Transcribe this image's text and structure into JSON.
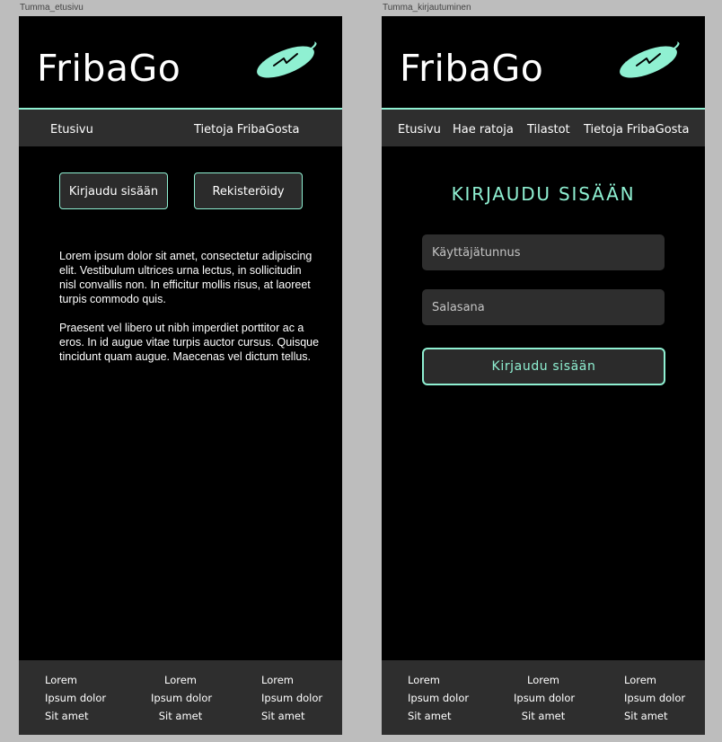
{
  "frames": [
    {
      "label": "Tumma_etusivu",
      "logo_text": "FribaGo",
      "nav": [
        "Etusivu",
        "Tietoja FribaGosta"
      ],
      "buttons": {
        "login": "Kirjaudu sisään",
        "register": "Rekisteröidy"
      },
      "paragraphs": [
        "Lorem ipsum dolor sit amet, consectetur adipiscing elit. Vestibulum ultrices urna lectus, in sollicitudin nisl convallis non. In efficitur mollis risus, at laoreet turpis commodo quis.",
        "Praesent vel libero ut nibh imperdiet porttitor ac a eros. In id augue vitae turpis auctor cursus. Quisque tincidunt quam augue. Maecenas vel dictum tellus."
      ],
      "footer": [
        [
          "Lorem",
          "Ipsum dolor",
          "Sit amet"
        ],
        [
          "Lorem",
          "Ipsum dolor",
          "Sit amet"
        ],
        [
          "Lorem",
          "Ipsum dolor",
          "Sit amet"
        ]
      ]
    },
    {
      "label": "Tumma_kirjautuminen",
      "logo_text": "FribaGo",
      "nav": [
        "Etusivu",
        "Hae ratoja",
        "Tilastot",
        "Tietoja FribaGosta"
      ],
      "title": "KIRJAUDU SISÄÄN",
      "username_placeholder": "Käyttäjätunnus",
      "password_placeholder": "Salasana",
      "submit": "Kirjaudu sisään",
      "footer": [
        [
          "Lorem",
          "Ipsum dolor",
          "Sit amet"
        ],
        [
          "Lorem",
          "Ipsum dolor",
          "Sit amet"
        ],
        [
          "Lorem",
          "Ipsum dolor",
          "Sit amet"
        ]
      ]
    }
  ],
  "colors": {
    "accent": "#8ff0d2",
    "background": "#000000",
    "bar": "#2e2e2e",
    "canvas": "#bdbdbd"
  },
  "icons": {
    "logo": "frisbee-disc-icon"
  }
}
